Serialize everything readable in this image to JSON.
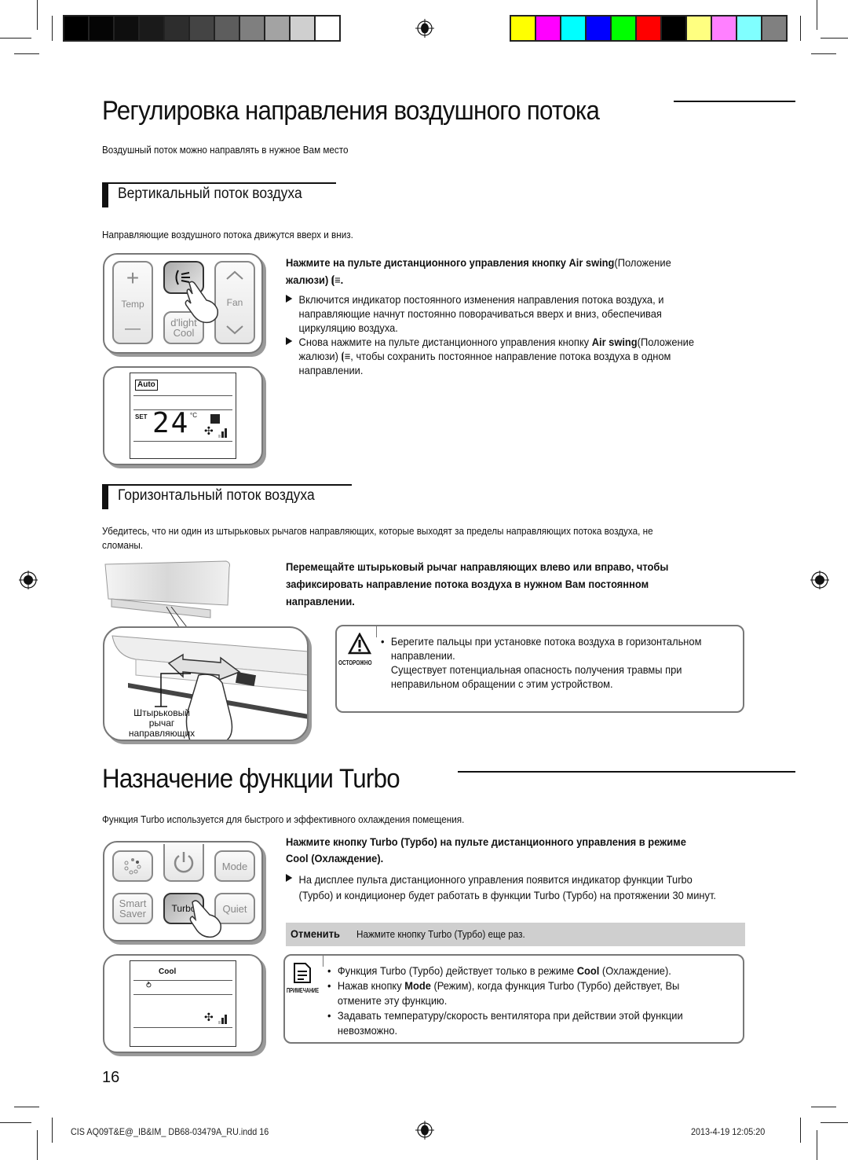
{
  "print_marks": {
    "grayscale_swatches": [
      "#000000",
      "#050505",
      "#0e0e0e",
      "#1a1a1a",
      "#2d2d2d",
      "#444444",
      "#5d5d5d",
      "#7f7f7f",
      "#a3a3a3",
      "#cfcfcf",
      "#ffffff"
    ],
    "color_swatches": [
      "#ffff00",
      "#ff00ff",
      "#00ffff",
      "#0000ff",
      "#00ff00",
      "#ff0000",
      "#000000",
      "#ffff80",
      "#ff80ff",
      "#80ffff",
      "#808080"
    ]
  },
  "section1": {
    "title": "Регулировка направления воздушного потока",
    "intro": "Воздушный поток можно направлять в нужное Вам место",
    "vertical": {
      "heading": "Вертикальный поток воздуха",
      "intro": "Направляющие воздушного потока движутся вверх и вниз.",
      "instruction_part1": "Нажмите на пульте дистанционного управления кнопку ",
      "instruction_bold": "Air swing",
      "instruction_part2": "(Положение",
      "instruction_line2": "жалюзи)",
      "instruction_end": ".",
      "bullets": [
        {
          "lines": [
            "Включится индикатор постоянного изменения направления потока воздуха, и",
            "направляющие начнут постоянно поворачиваться вверх и вниз, обеспечивая",
            "циркуляцию воздуха."
          ]
        },
        {
          "line1_part1": "Снова нажмите на пульте дистанционного управления кнопку ",
          "line1_bold": "Air swing",
          "line1_part2": "(Положение",
          "line2_part1": "жалюзи)",
          "line2_part2": ", чтобы сохранить постоянное направление потока воздуха в одном",
          "line3": "направлении."
        }
      ],
      "remote_buttons": {
        "temp_label": "Temp",
        "fan_label": "Fan",
        "dlight_label_1": "d'light",
        "dlight_label_2": "Cool",
        "plus": "+",
        "minus": "—"
      },
      "display": {
        "mode": "Auto",
        "set_label": "SET",
        "temperature": "24",
        "unit": "°C"
      }
    },
    "horizontal": {
      "heading": "Горизонтальный поток воздуха",
      "intro_line1": "Убедитесь, что ни один из штырьковых рычагов направляющих, которые выходят за пределы направляющих потока воздуха, не",
      "intro_line2": "сломаны.",
      "instruction_lines": [
        "Перемещайте штырьковый рычаг направляющих влево или вправо, чтобы",
        "зафиксировать направление потока воздуха в нужном Вам постоянном",
        "направлении."
      ],
      "illustration_label": [
        "Штырьковый",
        "рычаг",
        "направляющих"
      ],
      "caution": {
        "label": "ОСТОРОЖНО",
        "lines": [
          "Берегите пальцы при установке потока воздуха в горизонтальном",
          "направлении.",
          "Существует потенциальная опасность получения травмы при",
          "неправильном обращении с этим устройством."
        ]
      }
    }
  },
  "section2": {
    "title": "Назначение функции Turbo",
    "intro": "Функция Turbo используется для быстрого и эффективного охлаждения помещения.",
    "instruction_lines": [
      "Нажмите кнопку Turbo (Турбо) на пульте дистанционного управления в режиме",
      "Cool (Охлаждение)."
    ],
    "bullet_lines": [
      "На дисплее пульта дистанционного управления появится индикатор функции Turbo",
      "(Турбо) и кондиционер будет работать в функции Turbo (Турбо) на протяжении 30 минут."
    ],
    "cancel": {
      "label": "Отменить",
      "text": "Нажмите кнопку Turbo (Турбо) еще раз."
    },
    "remote_buttons": {
      "mode": "Mode",
      "smart_1": "Smart",
      "smart_2": "Saver",
      "turbo": "Turbo",
      "quiet": "Quiet"
    },
    "display": {
      "mode": "Cool"
    },
    "note": {
      "label": "ПРИМЕЧАНИЕ",
      "items": [
        {
          "part1": "Функция Turbo (Турбо) действует только в режиме ",
          "bold": "Cool",
          "part2": " (Охлаждение).",
          "cont": ""
        },
        {
          "part1": "Нажав кнопку ",
          "bold": "Mode",
          "part2": " (Режим), когда функция Turbo (Турбо) действует, Вы",
          "cont": "отмените эту функцию."
        },
        {
          "part1": "Задавать температуру/скорость вентилятора при действии этой функции",
          "bold": "",
          "part2": "",
          "cont": "невозможно."
        }
      ]
    }
  },
  "page_number": "16",
  "footer": {
    "file": "CIS AQ09T&E@_IB&IM_ DB68-03479A_RU.indd   16",
    "timestamp": "2013-4-19   12:05:20"
  }
}
